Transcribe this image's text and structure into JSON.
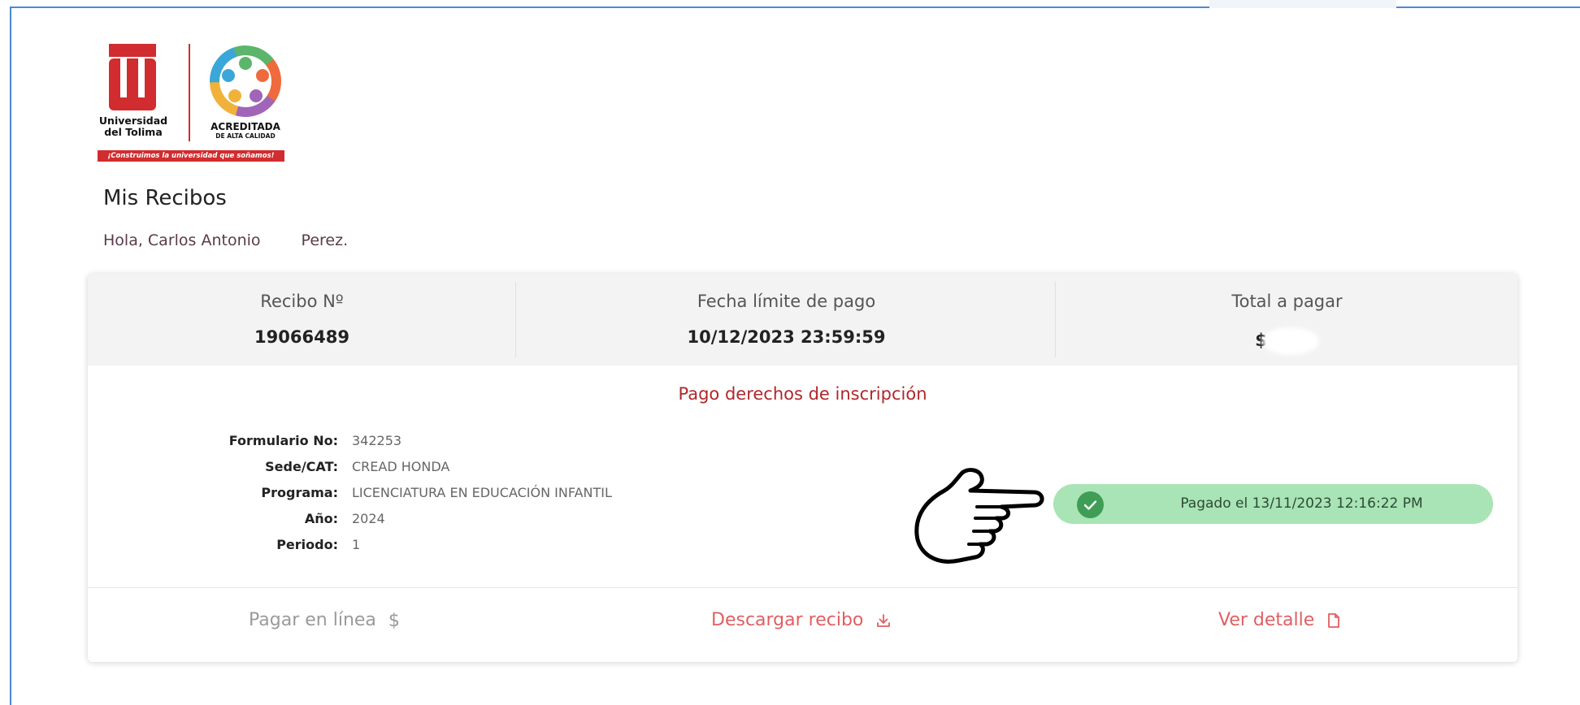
{
  "logo": {
    "university_line1": "Universidad",
    "university_line2": "del Tolima",
    "accredited_line1": "ACREDITADA",
    "accredited_line2": "DE ALTA CALIDAD",
    "slogan": "¡Construimos la universidad que soñamos!"
  },
  "page": {
    "title": "Mis Recibos",
    "greeting_first": "Hola, Carlos Antonio",
    "greeting_last": "Perez."
  },
  "receipt": {
    "number_label": "Recibo Nº",
    "number": "19066489",
    "due_label": "Fecha límite de pago",
    "due_date": "10/12/2023 23:59:59",
    "total_label": "Total a pagar",
    "total_currency": "$",
    "concept": "Pago derechos de inscripción",
    "details": [
      {
        "label": "Formulario No:",
        "value": "342253"
      },
      {
        "label": "Sede/CAT:",
        "value": "CREAD HONDA"
      },
      {
        "label": "Programa:",
        "value": "LICENCIATURA EN EDUCACIÓN INFANTIL"
      },
      {
        "label": "Año:",
        "value": "2024"
      },
      {
        "label": "Periodo:",
        "value": "1"
      }
    ],
    "status": "Pagado el 13/11/2023 12:16:22 PM",
    "status_color": "#a8e4b5"
  },
  "actions": {
    "pay_online": "Pagar en línea",
    "pay_online_symbol": "$",
    "download": "Descargar recibo",
    "view_detail": "Ver detalle"
  },
  "colors": {
    "accent_red": "#e25e61",
    "title_red": "#b0272b",
    "brand_red": "#d12c2f",
    "frame_blue": "#4a88d6"
  }
}
